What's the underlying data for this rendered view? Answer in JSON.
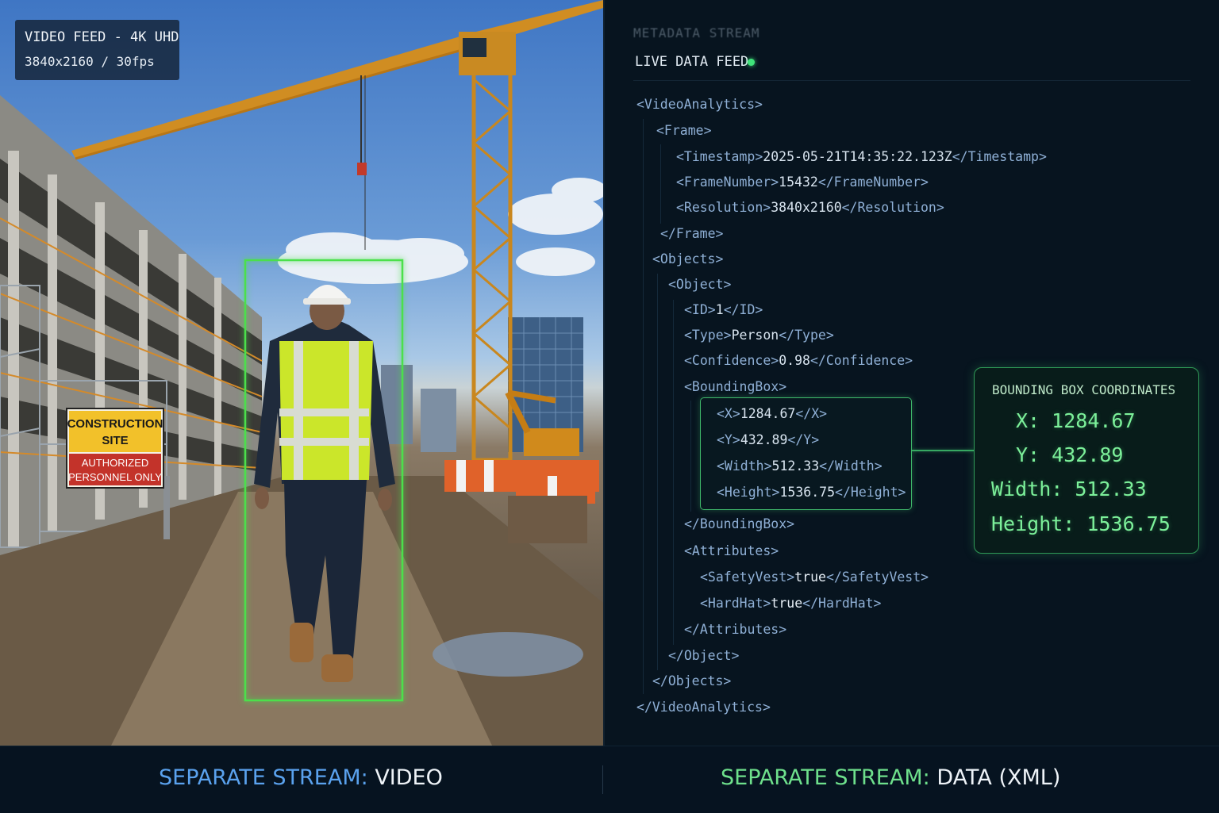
{
  "video": {
    "feed_title": "VIDEO FEED - 4K UHD",
    "feed_resolution": "3840x2160 / 30fps",
    "sign_line1": "CONSTRUCTION",
    "sign_line2": "SITE",
    "sign_line3": "AUTHORIZED",
    "sign_line4": "PERSONNEL ONLY",
    "detection_color": "#4be04b"
  },
  "data_panel": {
    "header_ghost": "METADATA STREAM",
    "live_label": "LIVE DATA FEED",
    "live_color": "#3fe37a",
    "xml": {
      "video_analytics_open": "<VideoAnalytics>",
      "frame_open": "<Frame>",
      "timestamp_open": "<Timestamp>",
      "timestamp_value": "2025-05-21T14:35:22.123Z",
      "timestamp_close": "</Timestamp>",
      "frame_number_open": "<FrameNumber>",
      "frame_number_value": "15432",
      "frame_number_close": "</FrameNumber>",
      "resolution_open": "<Resolution>",
      "resolution_value": "3840x2160",
      "resolution_close": "</Resolution>",
      "frame_close": "</Frame>",
      "objects_open": "<Objects>",
      "object_open": "<Object>",
      "id_open": "<ID>",
      "id_value": "1",
      "id_close": "</ID>",
      "type_open": "<Type>",
      "type_value": "Person",
      "type_close": "</Type>",
      "confidence_open": "<Confidence>",
      "confidence_value": "0.98",
      "confidence_close": "</Confidence>",
      "bbox_open": "<BoundingBox>",
      "x_open": "<X>",
      "x_value": "1284.67",
      "x_close": "</X>",
      "y_open": "<Y>",
      "y_value": "432.89",
      "y_close": "</Y>",
      "width_open": "<Width>",
      "width_value": "512.33",
      "width_close": "</Width>",
      "height_open": "<Height>",
      "height_value": "1536.75",
      "height_close": "</Height>",
      "bbox_close": "</BoundingBox>",
      "attributes_open": "<Attributes>",
      "vest_open": "<SafetyVest>",
      "vest_value": "true",
      "vest_close": "</SafetyVest>",
      "hat_open": "<HardHat>",
      "hat_value": "true",
      "hat_close": "</HardHat>",
      "attributes_close": "</Attributes>",
      "object_close": "</Object>",
      "objects_close": "</Objects>",
      "video_analytics_close": "</VideoAnalytics>"
    },
    "coords_card": {
      "title": "BOUNDING BOX COORDINATES",
      "x_label": "X:",
      "x_value": "1284.67",
      "y_label": "Y:",
      "y_value": "432.89",
      "width_label": "Width:",
      "width_value": "512.33",
      "height_label": "Height:",
      "height_value": "1536.75"
    }
  },
  "footer": {
    "left_prefix": "SEPARATE STREAM:",
    "left_suffix": "VIDEO",
    "right_prefix": "SEPARATE STREAM:",
    "right_suffix": "DATA (XML)"
  }
}
